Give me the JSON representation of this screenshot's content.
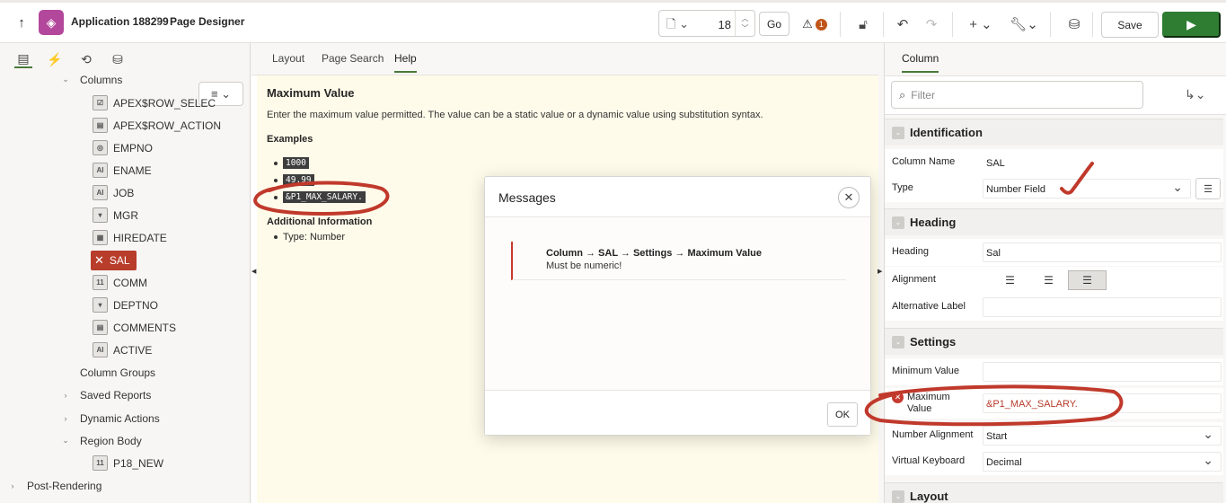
{
  "header": {
    "app_name": "Application 188299",
    "separator": "\\",
    "section": "Page Designer",
    "page_number": "18",
    "go_label": "Go",
    "message_count": "1",
    "save_label": "Save"
  },
  "left_panel": {
    "tree": {
      "columns_label": "Columns",
      "columns": [
        {
          "label": "APEX$ROW_SELEC",
          "icon": "☑"
        },
        {
          "label": "APEX$ROW_ACTION",
          "icon": "▤"
        },
        {
          "label": "EMPNO",
          "icon": "◎"
        },
        {
          "label": "ENAME",
          "icon": "AI"
        },
        {
          "label": "JOB",
          "icon": "AI"
        },
        {
          "label": "MGR",
          "icon": "▾"
        },
        {
          "label": "HIREDATE",
          "icon": "▦"
        },
        {
          "label": "SAL",
          "icon": "✕"
        },
        {
          "label": "COMM",
          "icon": "11"
        },
        {
          "label": "DEPTNO",
          "icon": "▾"
        },
        {
          "label": "COMMENTS",
          "icon": "▤"
        },
        {
          "label": "ACTIVE",
          "icon": "AI"
        }
      ],
      "column_groups": "Column Groups",
      "saved_reports": "Saved Reports",
      "dynamic_actions": "Dynamic Actions",
      "region_body": "Region Body",
      "p18_new": "P18_NEW",
      "post_rendering": "Post-Rendering"
    }
  },
  "center": {
    "tabs": [
      "Layout",
      "Page Search",
      "Help"
    ],
    "help": {
      "title": "Maximum Value",
      "description": "Enter the maximum value permitted. The value can be a static value or a dynamic value using substitution syntax.",
      "examples_label": "Examples",
      "examples": [
        "1000",
        "49.99",
        "&P1_MAX_SALARY."
      ],
      "additional_label": "Additional Information",
      "type_text": "Type: Number"
    }
  },
  "modal": {
    "title": "Messages",
    "message_path": "Column → SAL → Settings → Maximum Value",
    "message_text": "Must be numeric!",
    "ok_label": "OK"
  },
  "right_panel": {
    "tab": "Column",
    "filter_placeholder": "Filter",
    "groups": {
      "identification": "Identification",
      "heading": "Heading",
      "settings": "Settings",
      "layout": "Layout"
    },
    "props": {
      "column_name_label": "Column Name",
      "column_name_value": "SAL",
      "type_label": "Type",
      "type_value": "Number Field",
      "heading_label": "Heading",
      "heading_value": "Sal",
      "alignment_label": "Alignment",
      "alt_label_label": "Alternative Label",
      "min_value_label": "Minimum Value",
      "max_value_label": "Maximum Value",
      "max_value_value": "&P1_MAX_SALARY.",
      "number_alignment_label": "Number Alignment",
      "number_alignment_value": "Start",
      "virtual_keyboard_label": "Virtual Keyboard",
      "virtual_keyboard_value": "Decimal"
    }
  },
  "colors": {
    "accent_green": "#2e7d32",
    "error_red": "#b83d2b",
    "app_logo": "#b3479b",
    "annotation": "#c0392b"
  }
}
